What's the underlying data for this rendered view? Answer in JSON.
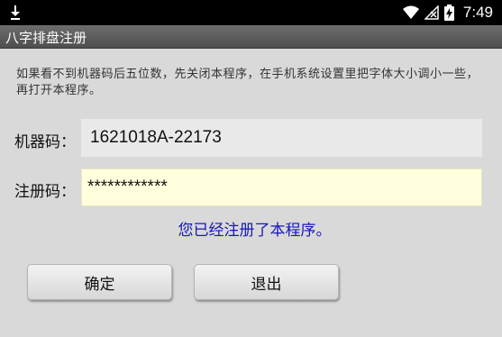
{
  "status_bar": {
    "time": "7:49",
    "icons": [
      "download-icon",
      "wifi-icon",
      "signal-off-icon",
      "battery-charging-icon"
    ]
  },
  "title_bar": {
    "title": "八字排盘注册"
  },
  "notice": "如果看不到机器码后五位数，先关闭本程序，在手机系统设置里把字体大小调小一些，再打开本程序。",
  "machine_code": {
    "label": "机器码：",
    "value": "1621018A-22173"
  },
  "registration_code": {
    "label": "注册码：",
    "value": "************"
  },
  "status_message": "您已经注册了本程序。",
  "buttons": {
    "ok": "确定",
    "exit": "退出"
  },
  "colors": {
    "status_bar_bg": "#000000",
    "title_bar_bg": "#5e5e5e",
    "page_bg": "#d9d9d9",
    "machine_field_bg": "#e9e9e9",
    "registration_field_bg": "#ffffdd",
    "status_message_text": "#1616b8"
  }
}
